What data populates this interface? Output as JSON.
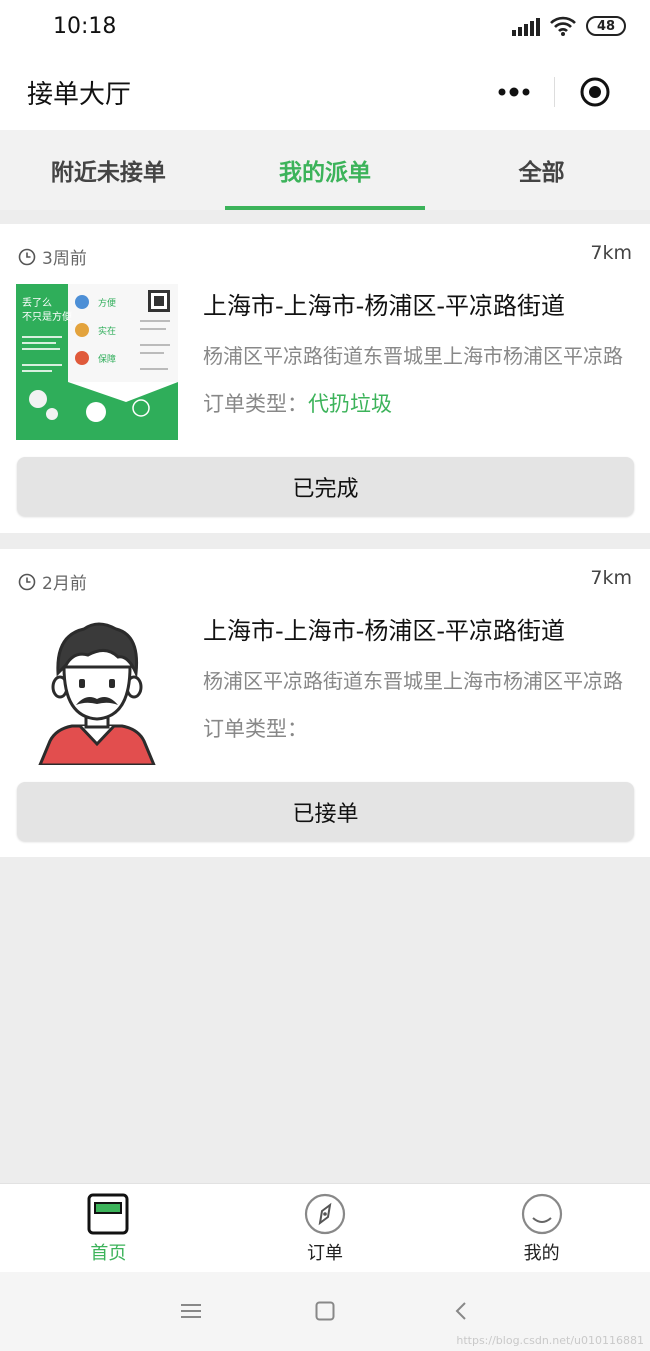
{
  "status": {
    "time": "10:18",
    "battery": "48"
  },
  "header": {
    "title": "接单大厅"
  },
  "tabs": [
    {
      "label": "附近未接单",
      "active": false
    },
    {
      "label": "我的派单",
      "active": true
    },
    {
      "label": "全部",
      "active": false
    }
  ],
  "orders": [
    {
      "time_ago": "3周前",
      "distance": "7km",
      "title": "上海市-上海市-杨浦区-平凉路街道",
      "address": "杨浦区平凉路街道东晋城里上海市杨浦区平凉路",
      "type_label": "订单类型：",
      "type_value": "代扔垃圾",
      "button_label": "已完成",
      "thumb_text": {
        "headline1": "丢了么",
        "headline2": "不只是方便",
        "tag1": "方便",
        "tag2": "实在",
        "tag3": "保障"
      }
    },
    {
      "time_ago": "2月前",
      "distance": "7km",
      "title": "上海市-上海市-杨浦区-平凉路街道",
      "address": "杨浦区平凉路街道东晋城里上海市杨浦区平凉路",
      "type_label": "订单类型：",
      "type_value": "",
      "button_label": "已接单"
    }
  ],
  "tabbar": [
    {
      "label": "首页",
      "icon": "home-icon",
      "active": true
    },
    {
      "label": "订单",
      "icon": "compass-icon",
      "active": false
    },
    {
      "label": "我的",
      "icon": "smile-icon",
      "active": false
    }
  ],
  "colors": {
    "accent": "#3cb35a",
    "background": "#ededed"
  },
  "watermark": "https://blog.csdn.net/u010116881"
}
